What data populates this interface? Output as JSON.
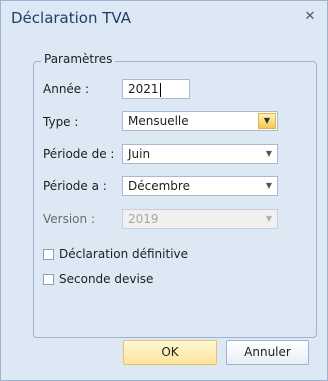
{
  "window": {
    "title": "Déclaration TVA",
    "close_glyph": "✕"
  },
  "group": {
    "legend": "Paramètres"
  },
  "fields": {
    "annee": {
      "label": "Année :",
      "value": "2021"
    },
    "type": {
      "label": "Type :",
      "value": "Mensuelle"
    },
    "periode_de": {
      "label": "Période de :",
      "value": "Juin"
    },
    "periode_a": {
      "label": "Période a :",
      "value": "Décembre"
    },
    "version": {
      "label": "Version :",
      "value": "2019"
    }
  },
  "checkboxes": {
    "declaration_definitive": {
      "label": "Déclaration définitive",
      "checked": false
    },
    "seconde_devise": {
      "label": "Seconde devise",
      "checked": false
    }
  },
  "buttons": {
    "ok": "OK",
    "annuler": "Annuler"
  },
  "icons": {
    "dropdown": "chevron-down-icon",
    "close": "close-icon"
  },
  "colors": {
    "dialog_bg": "#dde8f5",
    "border": "#9fb1cc",
    "ok_accent": "#fde49a",
    "title_text": "#1f3d6b"
  }
}
